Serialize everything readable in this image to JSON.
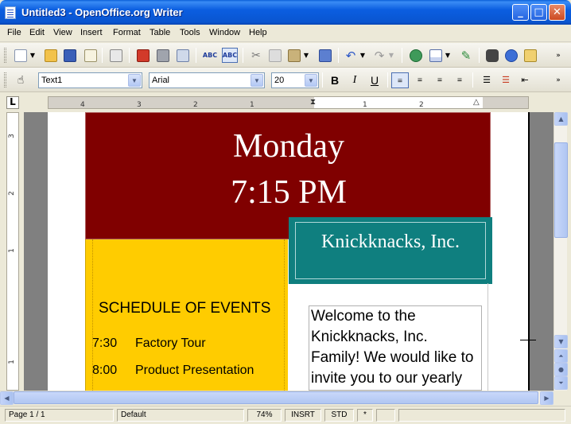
{
  "window": {
    "title": "Untitled3 - OpenOffice.org Writer"
  },
  "menu": [
    "File",
    "Edit",
    "View",
    "Insert",
    "Format",
    "Table",
    "Tools",
    "Window",
    "Help"
  ],
  "format_toolbar": {
    "style": "Text1",
    "font": "Arial",
    "size": "20",
    "bold": "B",
    "italic": "I",
    "underline": "U"
  },
  "ruler": {
    "h_ticks": [
      "4",
      "3",
      "2",
      "1",
      "1",
      "2"
    ],
    "v_ticks": [
      "3",
      "2",
      "1",
      "1"
    ],
    "corner": "L"
  },
  "document": {
    "day": "Monday",
    "time": "7:15 PM",
    "company": "Knickknacks, Inc.",
    "schedule_title": "SCHEDULE OF EVENTS",
    "schedule": [
      {
        "time": "7:30",
        "event": "Factory Tour"
      },
      {
        "time": "8:00",
        "event": "Product Presentation"
      }
    ],
    "welcome_lines": [
      "Welcome to the",
      "Knickknacks, Inc.",
      "Family! We would like to",
      "invite you to our yearly"
    ]
  },
  "status": {
    "page": "Page 1 / 1",
    "style": "Default",
    "zoom": "74%",
    "mode": "INSRT",
    "select": "STD",
    "modified": "*"
  },
  "icons": [
    "new-icon",
    "open-icon",
    "save-icon",
    "email-icon",
    "edit-icon",
    "pdf-icon",
    "print-icon",
    "preview-icon",
    "spellcheck-icon",
    "autospell-icon",
    "cut-icon",
    "copy-icon",
    "paste-icon",
    "format-paintbrush-icon",
    "undo-icon",
    "redo-icon",
    "hyperlink-icon",
    "table-icon",
    "draw-icon",
    "find-icon",
    "navigator-icon",
    "gallery-icon",
    "styles-icon"
  ]
}
